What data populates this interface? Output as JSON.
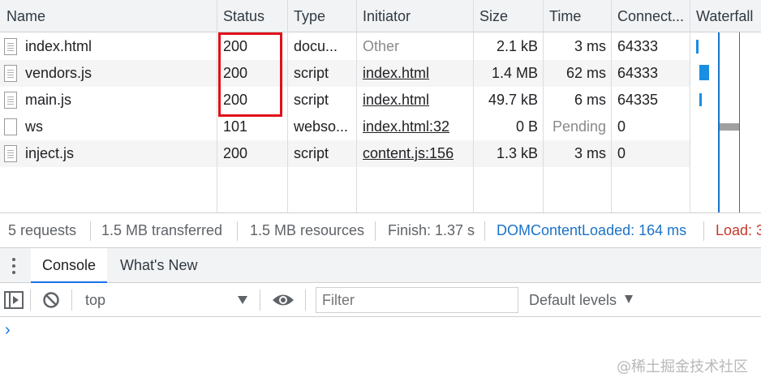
{
  "columns": {
    "name": "Name",
    "status": "Status",
    "type": "Type",
    "initiator": "Initiator",
    "size": "Size",
    "time": "Time",
    "connection": "Connect...",
    "waterfall": "Waterfall"
  },
  "rows": [
    {
      "name": "index.html",
      "status": "200",
      "type": "docu...",
      "initiator": "Other",
      "size": "2.1 kB",
      "time": "3 ms",
      "connection": "64333"
    },
    {
      "name": "vendors.js",
      "status": "200",
      "type": "script",
      "initiator": "index.html",
      "size": "1.4 MB",
      "time": "62 ms",
      "connection": "64333"
    },
    {
      "name": "main.js",
      "status": "200",
      "type": "script",
      "initiator": "index.html",
      "size": "49.7 kB",
      "time": "6 ms",
      "connection": "64335"
    },
    {
      "name": "ws",
      "status": "101",
      "type": "webso...",
      "initiator": "index.html:32",
      "size": "0 B",
      "time": "Pending",
      "connection": "0"
    },
    {
      "name": "inject.js",
      "status": "200",
      "type": "script",
      "initiator": "content.js:156",
      "size": "1.3 kB",
      "time": "3 ms",
      "connection": "0"
    }
  ],
  "summary": {
    "requests": "5 requests",
    "transferred": "1.5 MB transferred",
    "resources": "1.5 MB resources",
    "finish": "Finish: 1.37 s",
    "dcl": "DOMContentLoaded: 164 ms",
    "load": "Load: 3"
  },
  "drawer": {
    "tabs": [
      "Console",
      "What's New"
    ],
    "context": "top",
    "filter_placeholder": "Filter",
    "levels": "Default levels",
    "prompt": "›"
  },
  "watermark": "@稀土掘金技术社区",
  "colors": {
    "highlight_box": "#e0101a",
    "dcl": "#1a73c8",
    "load": "#c53929",
    "waterfall_bar": "#1a8ee1"
  }
}
